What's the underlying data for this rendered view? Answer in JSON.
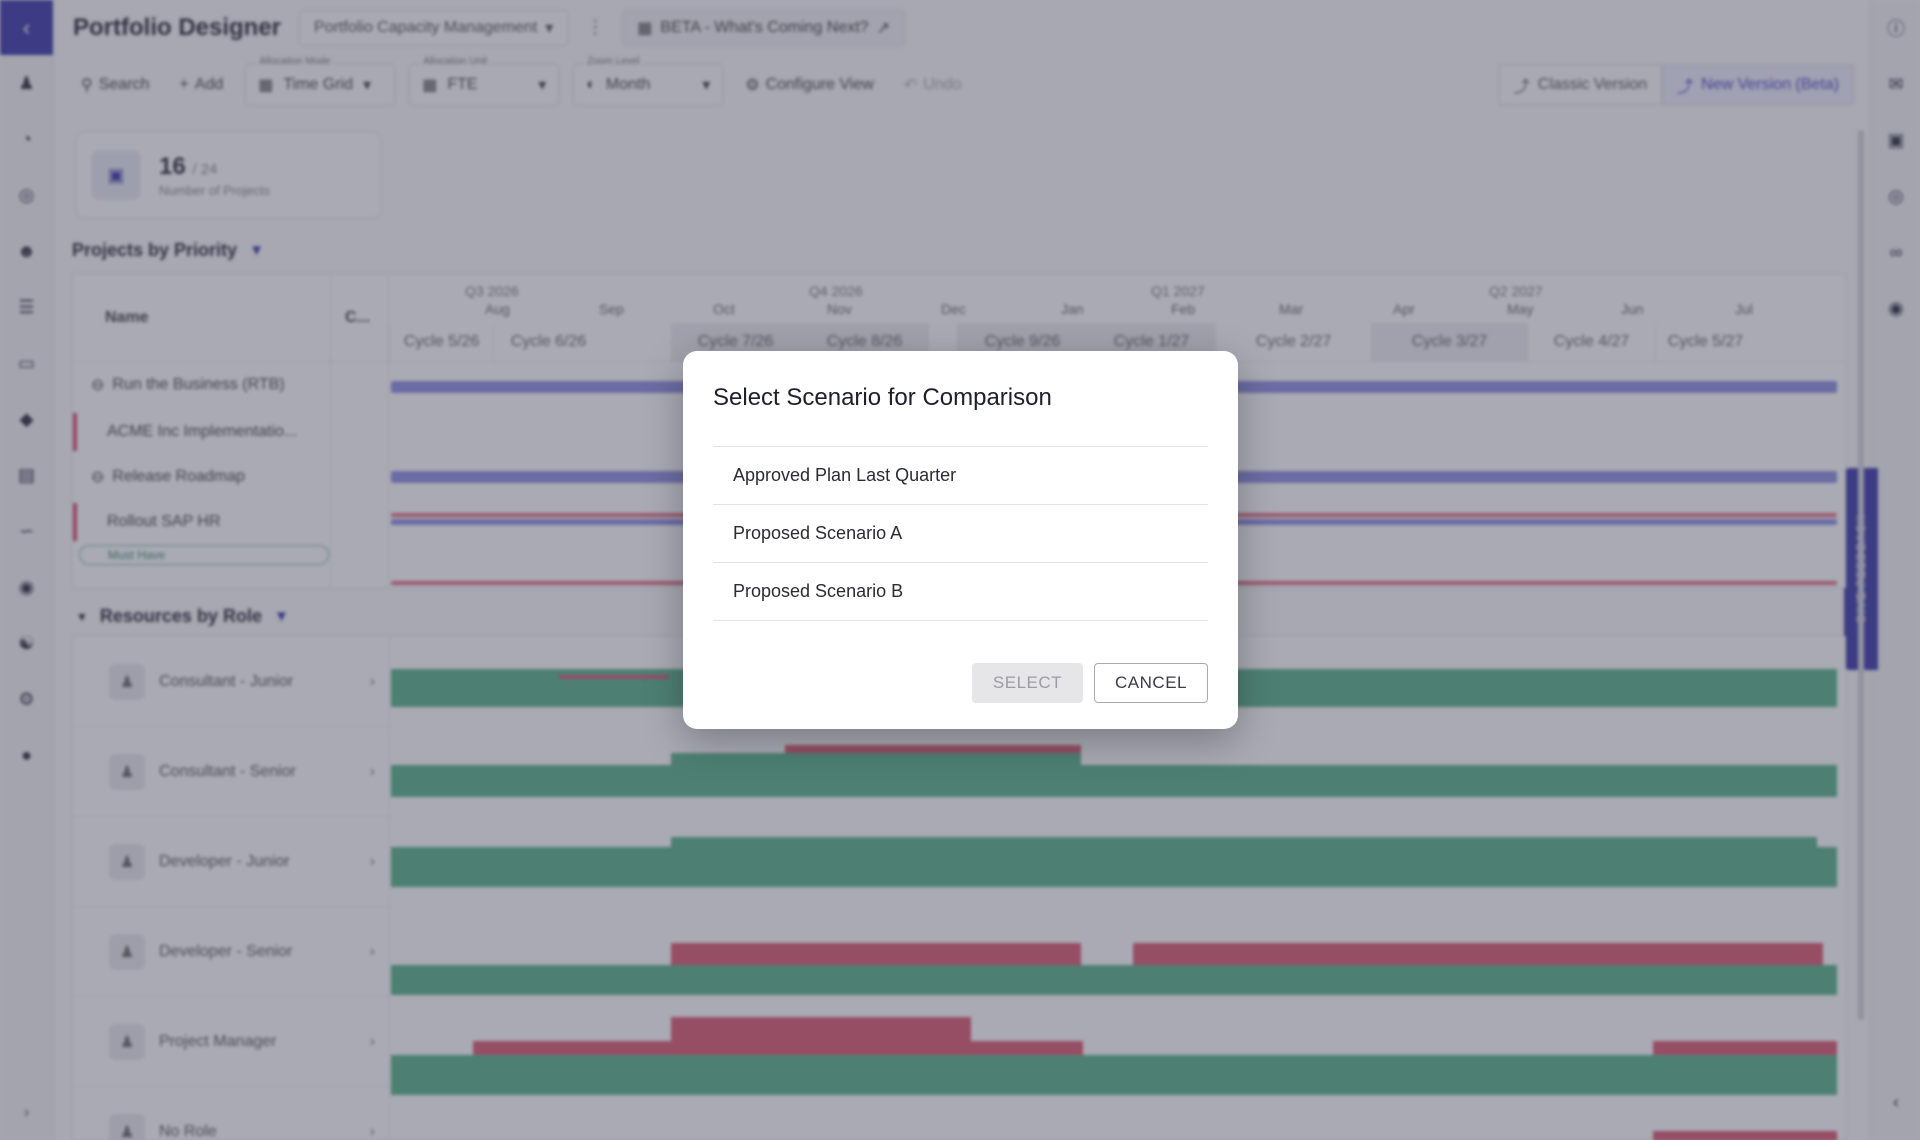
{
  "app": {
    "title": "Portfolio Designer",
    "workspace_select": "Portfolio Capacity Management",
    "beta_link": "BETA - What's Coming Next?"
  },
  "toolbar": {
    "search_label": "Search",
    "add_label": "Add",
    "allocation_mode": {
      "label": "Allocation Mode",
      "value": "Time Grid"
    },
    "allocation_unit": {
      "label": "Allocation Unit",
      "value": "FTE"
    },
    "zoom_level": {
      "label": "Zoom Level",
      "value": "Month"
    },
    "configure_view_label": "Configure View",
    "undo_label": "Undo",
    "classic_version_label": "Classic Version",
    "new_version_label": "New Version (Beta)"
  },
  "kpi": {
    "count": "16",
    "total": "/ 24",
    "subtitle": "Number of Projects"
  },
  "projects_section": {
    "title": "Projects by Priority",
    "col_name": "Name",
    "col_c": "C...",
    "rows": [
      {
        "label": "Run the Business (RTB)"
      },
      {
        "label": "ACME Inc Implementatio..."
      },
      {
        "label": "Release Roadmap"
      },
      {
        "label": "Rollout SAP HR"
      }
    ],
    "tag": "Must Have"
  },
  "timeline": {
    "quarters": [
      "Q3 2026",
      "Q4 2026",
      "Q1 2027",
      "Q2 2027"
    ],
    "months": [
      "Aug",
      "Sep",
      "Oct",
      "Nov",
      "Dec",
      "Jan",
      "Feb",
      "Mar",
      "Apr",
      "May",
      "Jun",
      "Jul"
    ],
    "cycles": [
      "Cycle 5/26",
      "Cycle 6/26",
      "Cycle 7/26",
      "Cycle 8/26",
      "Cycle 9/26",
      "Cycle 1/27",
      "Cycle 2/27",
      "Cycle 3/27",
      "Cycle 4/27",
      "Cycle 5/27"
    ]
  },
  "resources_section": {
    "title": "Resources by Role",
    "roles": [
      {
        "label": "Consultant - Junior"
      },
      {
        "label": "Consultant - Senior"
      },
      {
        "label": "Developer - Junior"
      },
      {
        "label": "Developer - Senior"
      },
      {
        "label": "Project Manager"
      },
      {
        "label": "No Role"
      }
    ]
  },
  "feedback_tab": "GIVE FEEDBACK",
  "dialog": {
    "title": "Select Scenario for Comparison",
    "options": [
      {
        "label": "Approved Plan Last Quarter"
      },
      {
        "label": "Proposed Scenario A"
      },
      {
        "label": "Proposed Scenario B"
      }
    ],
    "select_label": "SELECT",
    "cancel_label": "CANCEL",
    "select_enabled": false
  },
  "colors": {
    "brand": "#3d3aa8",
    "capacity_ok": "#5ab08a",
    "capacity_over": "#d85a74",
    "bar_blue": "#8e8de0"
  }
}
